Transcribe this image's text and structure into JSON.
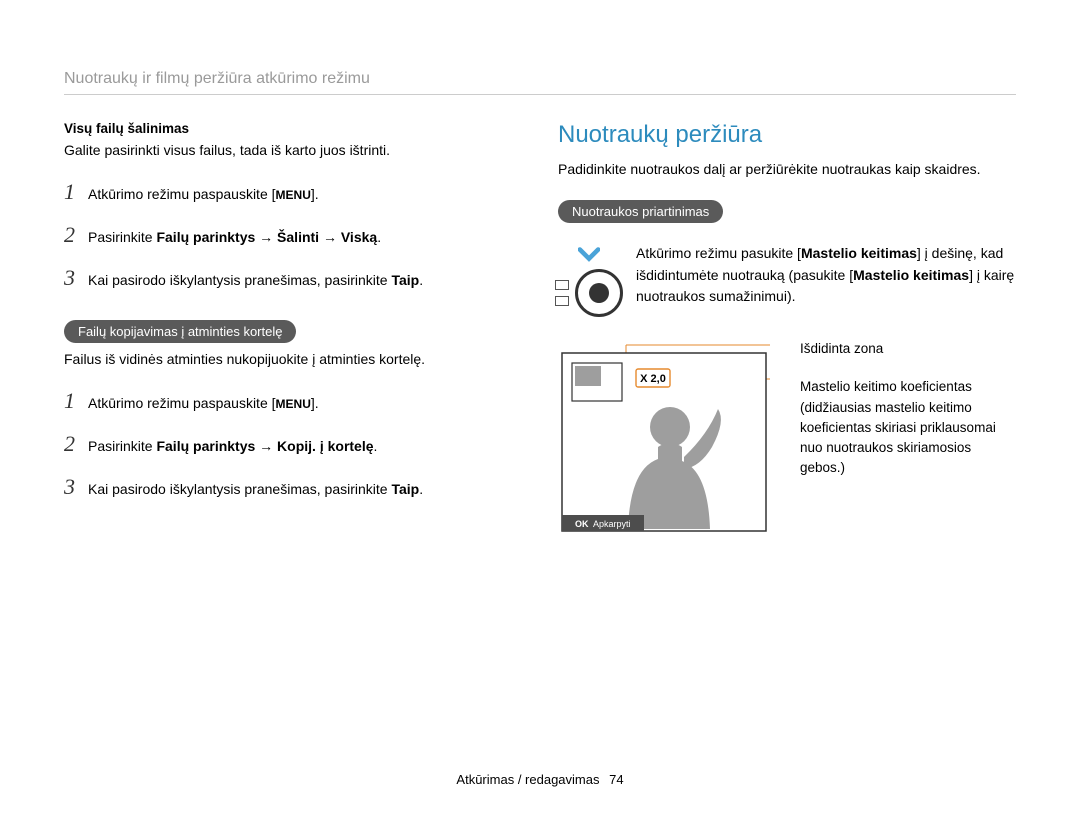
{
  "header": {
    "breadcrumb": "Nuotraukų ir filmų peržiūra atkūrimo režimu"
  },
  "left": {
    "delete_all_title": "Visų failų šalinimas",
    "delete_all_intro": "Galite pasirinkti visus failus, tada iš karto juos ištrinti.",
    "steps_a": [
      {
        "n": "1",
        "pre": "Atkūrimo režimu paspauskite [",
        "menu": "MENU",
        "post": "]."
      },
      {
        "n": "2",
        "pre": "Pasirinkite ",
        "bold": "Failų parinktys → Šalinti → Viską",
        "post": "."
      },
      {
        "n": "3",
        "pre": "Kai pasirodo iškylantysis pranešimas, pasirinkite ",
        "bold": "Taip",
        "post": "."
      }
    ],
    "copy_pill": "Failų kopijavimas į atminties kortelę",
    "copy_intro": "Failus iš vidinės atminties nukopijuokite į atminties kortelę.",
    "steps_b": [
      {
        "n": "1",
        "pre": "Atkūrimo režimu paspauskite [",
        "menu": "MENU",
        "post": "]."
      },
      {
        "n": "2",
        "pre": "Pasirinkite ",
        "bold": "Failų parinktys → Kopij. į kortelę",
        "post": "."
      },
      {
        "n": "3",
        "pre": "Kai pasirodo iškylantysis pranešimas, pasirinkite ",
        "bold": "Taip",
        "post": "."
      }
    ]
  },
  "right": {
    "title": "Nuotraukų peržiūra",
    "intro": "Padidinkite nuotraukos dalį ar peržiūrėkite nuotraukas kaip skaidres.",
    "zoom_pill": "Nuotraukos priartinimas",
    "zoom_text_parts": {
      "a": "Atkūrimo režimu pasukite [",
      "b": "Mastelio keitimas",
      "c": "] į dešinę, kad išdidintumėte nuotrauką (pasukite [",
      "d": "Mastelio keitimas",
      "e": "] į kairę nuotraukos sumažinimui)."
    },
    "diagram": {
      "zoom_badge": "X 2,0",
      "ok": "OK",
      "crop": "Apkarpyti",
      "label1": "Išdidinta zona",
      "label2": "Mastelio keitimo koeficientas (didžiausias mastelio keitimo koeficientas skiriasi priklausomai nuo nuotraukos skiriamosios gebos.)"
    }
  },
  "footer": {
    "section": "Atkūrimas / redagavimas",
    "page": "74"
  }
}
